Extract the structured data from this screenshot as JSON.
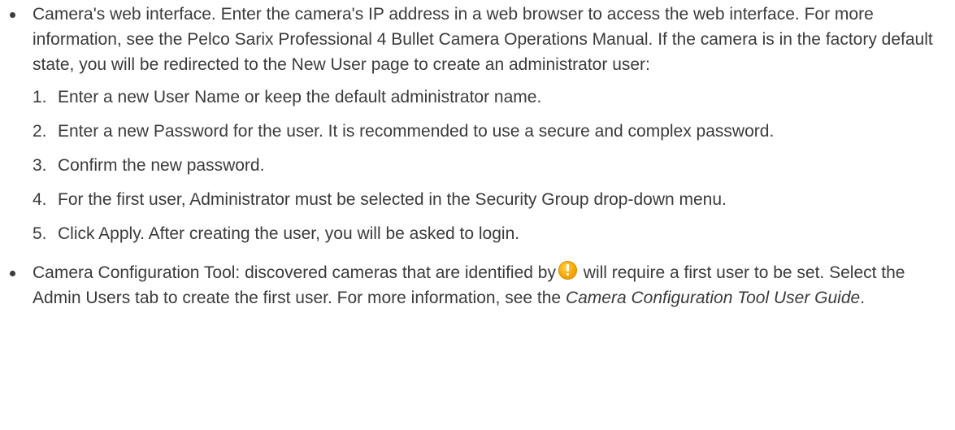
{
  "bullets": {
    "first": {
      "text": "Camera's web interface. Enter the camera's IP address in a web browser to access the web interface. For more information, see the Pelco Sarix Professional 4 Bullet Camera Operations Manual. If the camera is in the factory default state, you will be redirected to the New User page to create an administrator user:",
      "steps": [
        {
          "num": "1.",
          "text": "Enter a new User Name or keep the default administrator name."
        },
        {
          "num": "2.",
          "text": "Enter a new Password for the user. It is recommended to use a secure and complex password."
        },
        {
          "num": "3.",
          "text": "Confirm the new password."
        },
        {
          "num": "4.",
          "text": "For the first user, Administrator must be selected in the Security Group drop-down menu."
        },
        {
          "num": "5.",
          "text": "Click Apply. After creating the user, you will be asked to login."
        }
      ]
    },
    "second": {
      "text_before_icon": "Camera Configuration Tool: discovered cameras that are identified by",
      "icon": "warning-circle-icon",
      "icon_color": "#f6a400",
      "text_after_icon": " will require a first user to be set. Select the Admin Users tab to create the first user. For more information, see the ",
      "guide_title": "Camera Configuration Tool User Guide",
      "text_end": "."
    }
  },
  "colors": {
    "text": "#3b3b3b",
    "background": "#ffffff"
  }
}
